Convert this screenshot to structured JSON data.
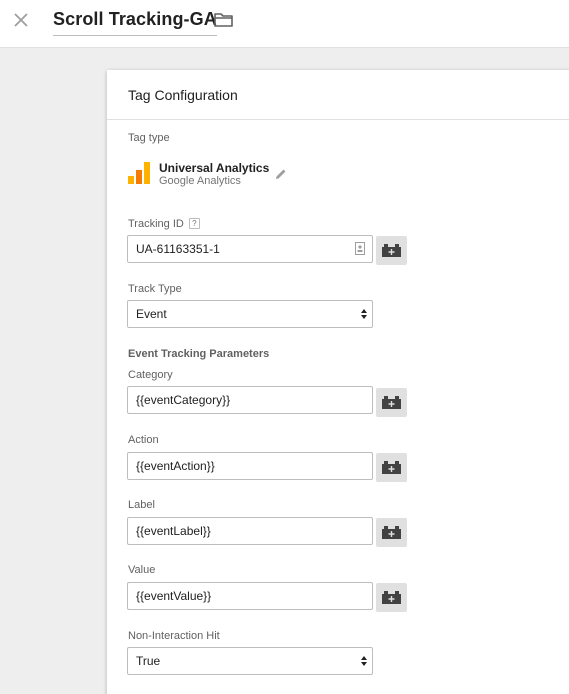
{
  "header": {
    "title": "Scroll Tracking-GA"
  },
  "card": {
    "title": "Tag Configuration",
    "tag_type_label": "Tag type",
    "tag_name": "Universal Analytics",
    "tag_vendor": "Google Analytics",
    "tracking_id_label": "Tracking ID",
    "tracking_id_help": "?",
    "tracking_id_value": "UA-61163351-1",
    "track_type_label": "Track Type",
    "track_type_value": "Event",
    "event_params_heading": "Event Tracking Parameters",
    "category_label": "Category",
    "category_value": "{{eventCategory}}",
    "action_label": "Action",
    "action_value": "{{eventAction}}",
    "label_label": "Label",
    "label_value": "{{eventLabel}}",
    "value_label": "Value",
    "value_value": "{{eventValue}}",
    "non_interaction_label": "Non-Interaction Hit",
    "non_interaction_value": "True"
  },
  "icons": {
    "close": "close-icon",
    "folder": "folder-icon",
    "ga_logo": "google-analytics-logo",
    "edit": "pencil-icon",
    "variable": "variable-picker-icon"
  },
  "colors": {
    "ga_orange": "#f57c00",
    "ga_yellow": "#ffb300",
    "background": "#eeeeee"
  }
}
